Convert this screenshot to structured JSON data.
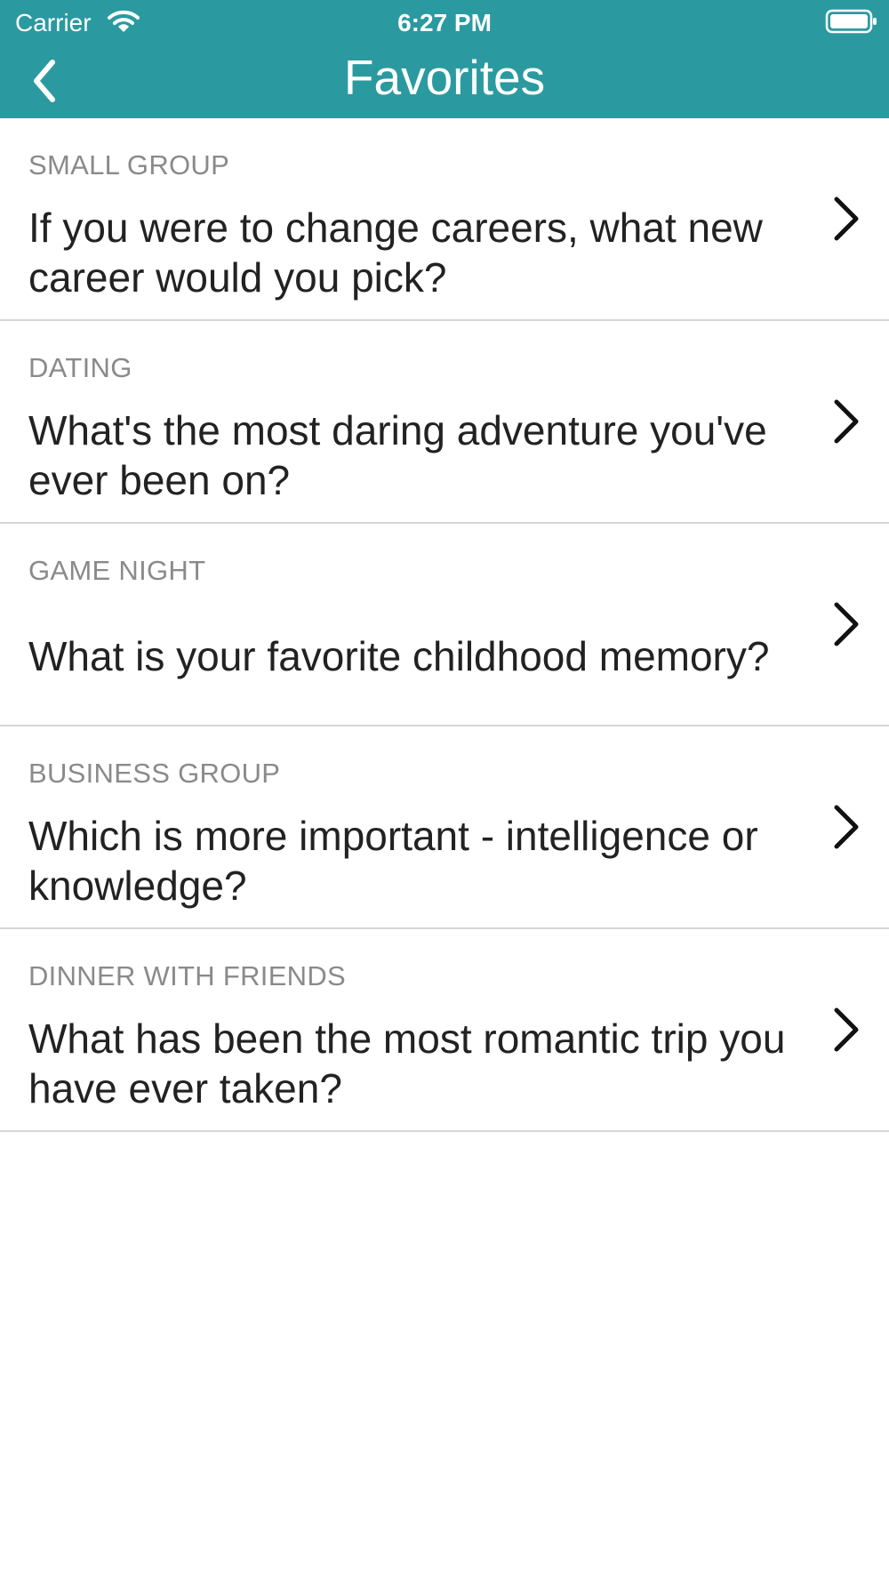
{
  "status_bar": {
    "carrier": "Carrier",
    "time": "6:27 PM"
  },
  "nav": {
    "title": "Favorites"
  },
  "icons": {
    "back": "chevron-left-icon",
    "row": "chevron-right-icon",
    "wifi": "wifi-icon",
    "battery": "battery-icon"
  },
  "colors": {
    "header": "#2a9aa0",
    "category": "#8a8a8a",
    "question": "#222222",
    "divider": "#d6d6d6"
  },
  "favorites": [
    {
      "category": "SMALL GROUP",
      "question": "If you were to change careers, what new career would you pick?"
    },
    {
      "category": "DATING",
      "question": "What's the most daring adventure you've ever been on?"
    },
    {
      "category": "GAME NIGHT",
      "question": "What is your favorite childhood memory?"
    },
    {
      "category": "BUSINESS GROUP",
      "question": "Which is more important - intelligence or knowledge?"
    },
    {
      "category": "DINNER WITH FRIENDS",
      "question": "What has been the most romantic trip you have ever taken?"
    }
  ]
}
